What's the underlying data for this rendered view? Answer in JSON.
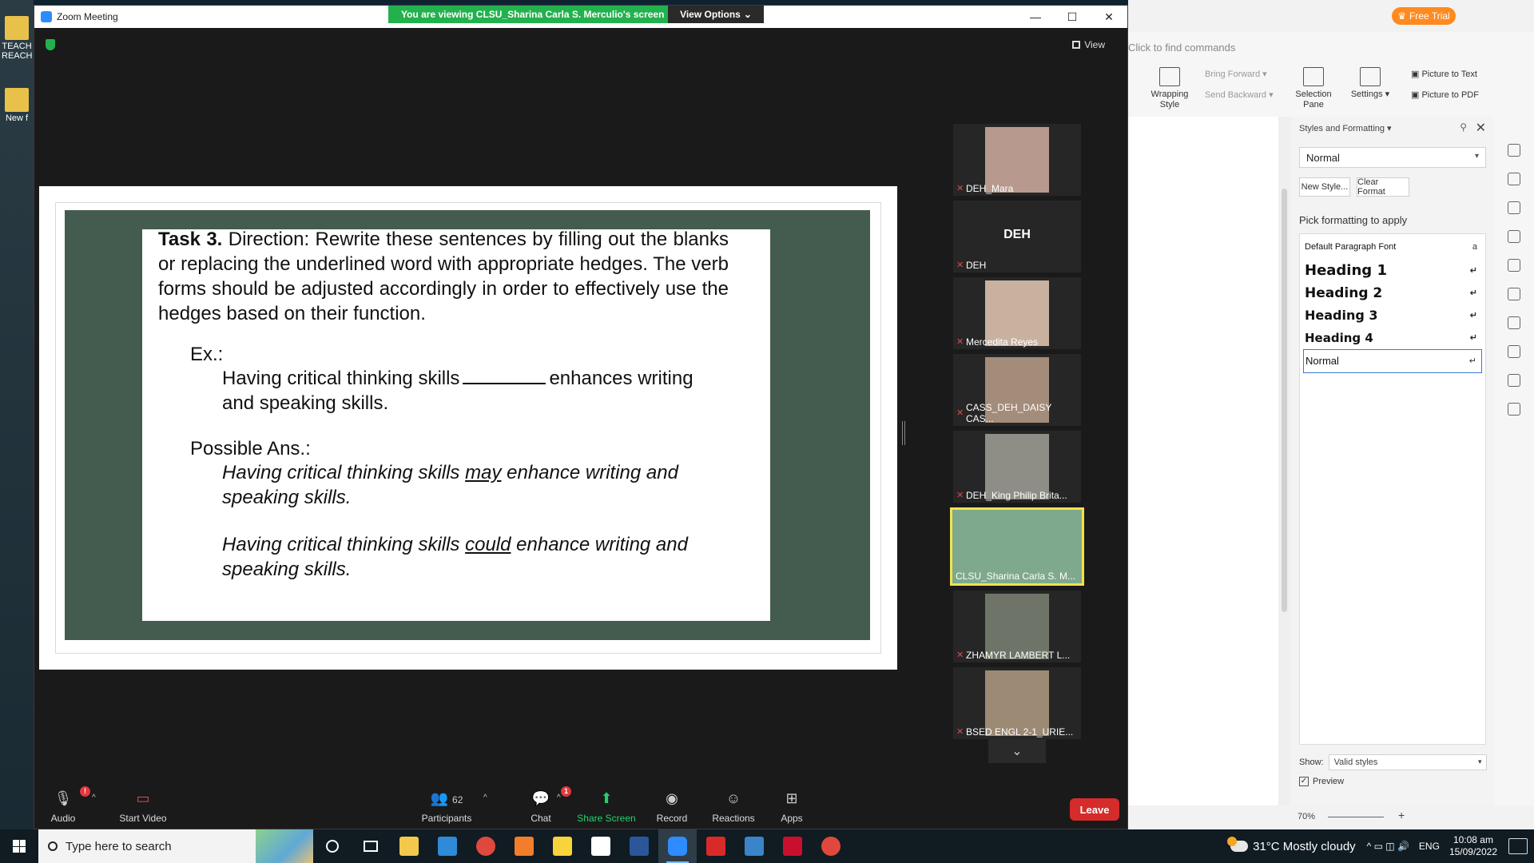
{
  "desktop": {
    "icons": [
      {
        "label": "TEACH REACH"
      },
      {
        "label": "New f"
      }
    ]
  },
  "zoom": {
    "title": "Zoom Meeting",
    "banner": "You are viewing CLSU_Sharina Carla S. Merculio's screen",
    "view_options": "View Options",
    "view_label": "View",
    "slide": {
      "task_bold": "Task 3.",
      "task_text": " Direction: Rewrite these sentences by filling out the blanks or replacing the underlined word with appropriate hedges. The verb forms should be adjusted accordingly in order to effectively use the hedges based on their function.",
      "ex_label": "Ex.:",
      "ex_text_before": "Having critical thinking skills",
      "ex_text_after": "enhances writing and speaking skills.",
      "possible_label": "Possible Ans.:",
      "ans1_before": "Having critical thinking skills ",
      "ans1_u": "may",
      "ans1_after": " enhance writing and speaking skills.",
      "ans2_before": "Having critical thinking skills ",
      "ans2_u": "could",
      "ans2_after": " enhance writing and speaking skills."
    },
    "participants": [
      {
        "name": "DEH_Mara"
      },
      {
        "name": "DEH",
        "initials": "DEH"
      },
      {
        "name": "Mercedita Reyes"
      },
      {
        "name": "CASS_DEH_DAISY CAS..."
      },
      {
        "name": "DEH_King Philip Brita..."
      },
      {
        "name": "CLSU_Sharina Carla S. M..."
      },
      {
        "name": "ZHAMYR LAMBERT L..."
      },
      {
        "name": "BSED ENGL 2-1_URIE..."
      }
    ],
    "toolbar": {
      "audio": "Audio",
      "start_video": "Start Video",
      "participants": "Participants",
      "participants_count": "62",
      "chat": "Chat",
      "chat_badge": "1",
      "audio_badge": "!",
      "share_screen": "Share Screen",
      "record": "Record",
      "reactions": "Reactions",
      "apps": "Apps",
      "leave": "Leave"
    }
  },
  "wps": {
    "free_trial": "Free Trial",
    "find_commands": "Click to find commands",
    "ribbon": {
      "wrapping_style": "Wrapping Style",
      "bring_forward": "Bring Forward",
      "send_backward": "Send Backward",
      "selection_pane": "Selection Pane",
      "settings": "Settings",
      "picture_to_text": "Picture to Text",
      "picture_to_pdf": "Picture to PDF"
    },
    "panel": {
      "title": "Styles and Formatting",
      "current_style": "Normal",
      "new_style": "New Style...",
      "clear_format": "Clear Format",
      "pick_label": "Pick formatting to apply",
      "styles": [
        "Default Paragraph Font",
        "Heading 1",
        "Heading 2",
        "Heading 3",
        "Heading 4",
        "Normal"
      ],
      "show_label": "Show:",
      "show_value": "Valid styles",
      "preview_label": "Preview"
    },
    "status": {
      "zoom": "70%"
    }
  },
  "taskbar": {
    "search_placeholder": "Type here to search",
    "weather": "31°C  Mostly cloudy",
    "lang": "ENG",
    "time": "10:08 am",
    "date": "15/09/2022"
  },
  "colors": {
    "zoom_green": "#23b14d",
    "leave_red": "#d52b2b",
    "slide_bg": "#435c4f",
    "active_speaker": "#f0e34e",
    "free_trial_orange": "#ff8a20"
  }
}
